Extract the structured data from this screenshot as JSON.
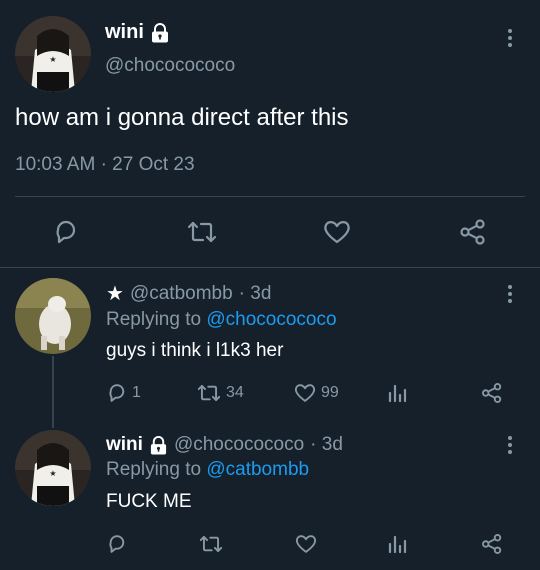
{
  "main_tweet": {
    "display_name": "wini",
    "handle": "@chococococo",
    "text": "how am i gonna direct after this",
    "time": "10:03 AM",
    "date": "27 Oct 23"
  },
  "reply1": {
    "star": "★",
    "handle": "@catbombb",
    "age": "· 3d",
    "replying_to_label": "Replying to",
    "replying_to": "@chococococo",
    "text": "guys i think i l1k3 her",
    "stats": {
      "replies": "1",
      "retweets": "34",
      "likes": "99"
    }
  },
  "reply2": {
    "display_name": "wini",
    "handle": "@chococococo",
    "age": "· 3d",
    "replying_to_label": "Replying to",
    "replying_to": "@catbombb",
    "text": "FUCK ME"
  },
  "colors": {
    "background": "#15202b",
    "muted": "#8899a6",
    "link": "#1d9bf0",
    "divider": "#38444d"
  },
  "icons": [
    "lock-icon",
    "more-icon",
    "reply-icon",
    "retweet-icon",
    "like-icon",
    "share-icon",
    "analytics-icon",
    "star-icon"
  ]
}
